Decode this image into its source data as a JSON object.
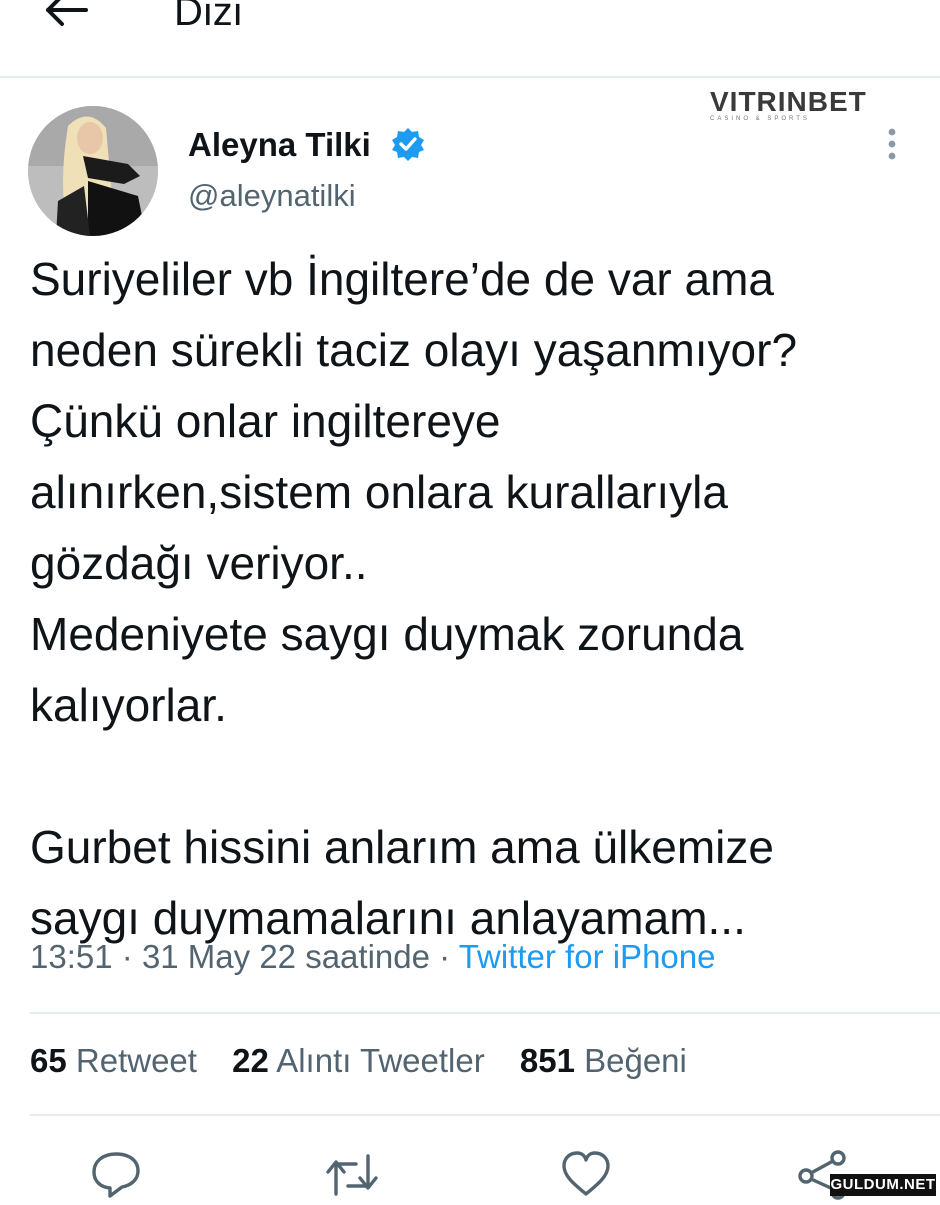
{
  "header": {
    "title": "Dizi"
  },
  "watermark_top": {
    "brand": "VITRINBET",
    "tagline": "CASINO & SPORTS"
  },
  "author": {
    "name": "Aleyna Tilki",
    "handle": "@aleynatilki"
  },
  "tweet": {
    "lines": [
      "Suriyeliler vb İngiltere’de de var ama",
      "neden sürekli taciz olayı yaşanmıyor?",
      "Çünkü onlar ingiltereye",
      "alınırken,sistem onlara kurallarıyla",
      "gözdağı veriyor..",
      "Medeniyete saygı duymak zorunda",
      "kalıyorlar.",
      "",
      "Gurbet hissini anlarım ama ülkemize",
      "saygı duymamalarını anlayamam..."
    ],
    "time": "13:51",
    "date": "31 May 22 saatinde",
    "source": "Twitter for iPhone"
  },
  "stats": {
    "retweets": {
      "count": "65",
      "label": "Retweet"
    },
    "quotes": {
      "count": "22",
      "label": "Alıntı Tweetler"
    },
    "likes": {
      "count": "851",
      "label": "Beğeni"
    }
  },
  "actions": {
    "icons": [
      "reply-icon",
      "retweet-icon",
      "like-icon",
      "share-icon"
    ],
    "color": "#536471"
  },
  "watermark_bottom": {
    "text": "GULDUM.NET"
  },
  "colors": {
    "link": "#1d9bf0",
    "verified": "#1d9bf0",
    "secondary_text": "#536471",
    "primary_text": "#0f1419"
  }
}
